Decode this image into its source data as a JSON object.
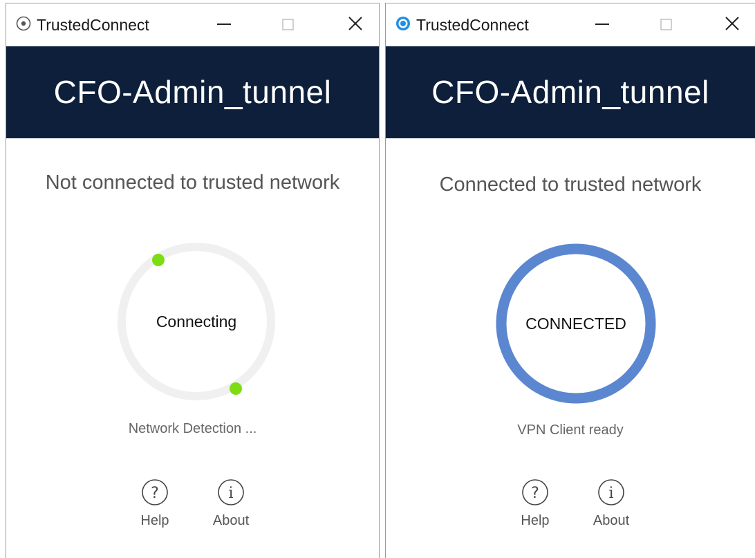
{
  "windows": [
    {
      "title": "TrustedConnect",
      "tunnel_name": "CFO-Admin_tunnel",
      "status_text": "Not connected to trusted network",
      "ring_label": "Connecting",
      "sub_status": "Network Detection ...",
      "state": "connecting",
      "help_label": "Help",
      "about_label": "About",
      "icon": "app-icon-inactive"
    },
    {
      "title": "TrustedConnect",
      "tunnel_name": "CFO-Admin_tunnel",
      "status_text": "Connected to trusted network",
      "ring_label": "CONNECTED",
      "sub_status": "VPN Client ready",
      "state": "connected",
      "help_label": "Help",
      "about_label": "About",
      "icon": "app-icon-active"
    }
  ],
  "colors": {
    "banner": "#0d1f3a",
    "ring_connected": "#5b87d1",
    "ring_track": "#f0f0f0",
    "connecting_dot": "#7ddc14",
    "active_icon": "#1e90e6"
  }
}
